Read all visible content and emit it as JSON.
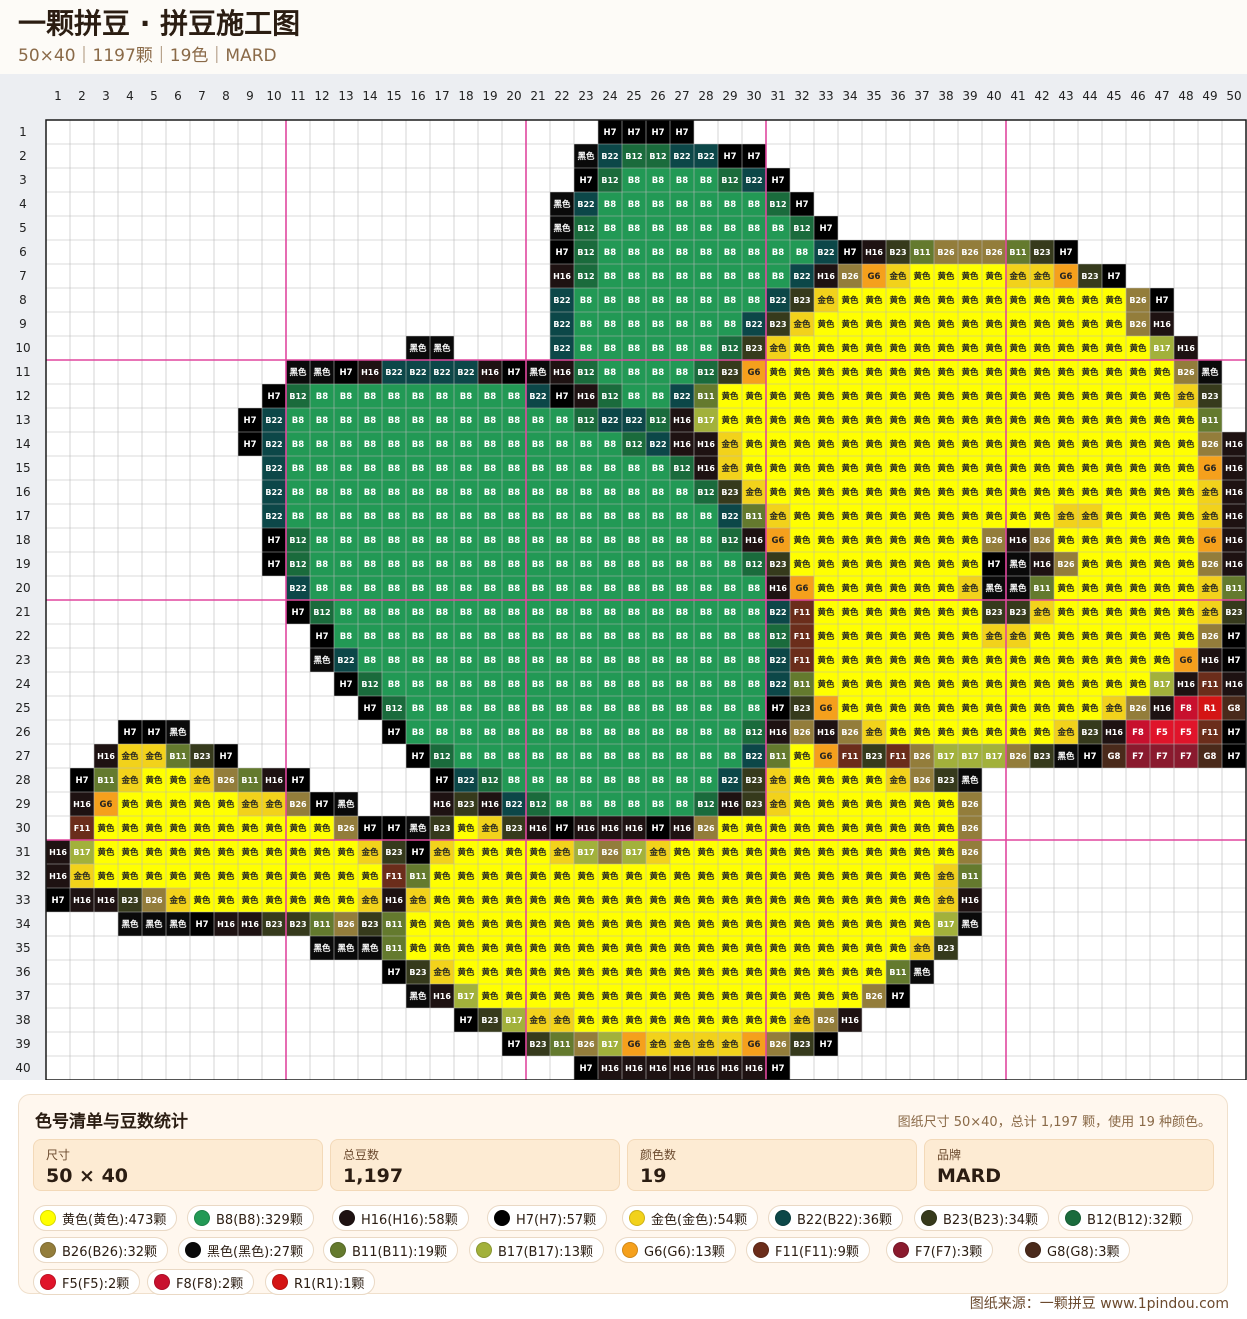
{
  "header": {
    "title": "一颗拼豆 · 拼豆施工图",
    "subtitle": "50×40｜1197颗｜19色｜MARD"
  },
  "grid": {
    "cols": 50,
    "rows": 40,
    "colors": {
      "Y": {
        "code": "黄色",
        "hex": "#ffff00",
        "dark": false
      },
      "J": {
        "code": "金色",
        "hex": "#f2d21b",
        "dark": false
      },
      "8": {
        "code": "B8",
        "hex": "#229955",
        "dark": true
      },
      "6": {
        "code": "H16",
        "hex": "#1e1212",
        "dark": true
      },
      "7": {
        "code": "H7",
        "hex": "#000000",
        "dark": true
      },
      "2": {
        "code": "B22",
        "hex": "#0c4748",
        "dark": true
      },
      "3": {
        "code": "B23",
        "hex": "#363a1c",
        "dark": true
      },
      "1": {
        "code": "B12",
        "hex": "#1a6b3c",
        "dark": true
      },
      "s": {
        "code": "B26",
        "hex": "#937d3b",
        "dark": true
      },
      "K": {
        "code": "黑色",
        "hex": "#0a0a0a",
        "dark": true
      },
      "o": {
        "code": "B11",
        "hex": "#647a2e",
        "dark": true
      },
      "r": {
        "code": "B17",
        "hex": "#a2b13b",
        "dark": true
      },
      "g": {
        "code": "G6",
        "hex": "#f5a01c",
        "dark": false
      },
      "F": {
        "code": "F11",
        "hex": "#6b2d1b",
        "dark": true
      },
      "7F": {
        "code": "F7",
        "hex": "#8a1a2e",
        "dark": true
      },
      "G": {
        "code": "G8",
        "hex": "#4a2a1b",
        "dark": true
      },
      "5": {
        "code": "F5",
        "hex": "#e0142a",
        "dark": true
      },
      "9": {
        "code": "F8",
        "hex": "#c8102e",
        "dark": true
      },
      "R": {
        "code": "R1",
        "hex": "#d41414",
        "dark": true
      }
    },
    "rows_data": [
      [
        "24:7,25:7,26:7,27:7"
      ],
      [
        "23:K,24:2,25:1,26:1,27:2,28:2,29:7,30:7"
      ],
      [
        "23:7,24:1,25-28:8,29:1,30:2,31:7"
      ],
      [
        "22:K,23:2,24-30:8,31:1,32:7"
      ],
      [
        "22:K,23:1,24-31:8,32:1,33:7"
      ],
      [
        "22:7,23:1,24-32:8,33:2,34:7,35:6,36:3,37:o,38:s,39:s,40:s,41:o,42:3,43:7"
      ],
      [
        "22:6,23:1,24-31:8,32:2,33:6,34:s,35:g,36:J,37-40:Y,41:J,42:J,43:g,44:3,45:7"
      ],
      [
        "22:2,23-30:8,31:2,32:3,33:J,34-45:Y,46:s,47:7"
      ],
      [
        "22:2,23-29:8,30:2,31:3,32:J,33-45:Y,46:s,47:6"
      ],
      [
        "16:K,17:K,22:2,23-28:8,29:1,30:3,31:J,32-46:Y,47:r,48:6"
      ],
      [
        "11:K,12:K,13:7,14:6,15:2,16:2,17:2,18:2,19:6,20:7,21:K,22:6,23:1,24-27:8,28:1,29:3,30:g,31-47:Y,48:s,49:K"
      ],
      [
        "10:7,11:1,12-20:8,21:2,22:7,23:6,24:1,25:8,26:8,27:2,28:o,29-47:Y,48:J,49:3"
      ],
      [
        "9:7,10:2,11-22:8,23:1,24:2,25:2,26:1,27:6,28:r,29-48:Y,49:o"
      ],
      [
        "9:7,10:2,11-24:8,25:1,26:2,27:6,28:6,29:J,30-48:Y,49:s,50:6"
      ],
      [
        "10:2,11-26:8,27:1,28:6,29:J,30-48:Y,49:g,50:6"
      ],
      [
        "10:2,11-27:8,28:1,29:3,30:J,31-48:Y,49:J,50:6"
      ],
      [
        "10:2,11-28:8,29:2,30:o,31:J,32-42:Y,43:J,44:J,45-48:Y,49:J,50:6"
      ],
      [
        "10:7,11:1,12-28:8,29:1,30:6,31:g,32-39:Y,40:s,41:6,42:s,43-48:Y,49:g,50:6"
      ],
      [
        "10:7,11:1,12-29:8,30:1,31:3,32-39:Y,40:7,41:K,42:6,43:s,44-48:Y,49:s,50:6"
      ],
      [
        "11:2,12-30:8,31:6,32:g,33-38:Y,39:J,40:K,41:K,42:o,43-48:Y,49:J,50:o"
      ],
      [
        "11:7,12:1,13-30:8,31:2,32:F,33-39:Y,40:3,41:3,42:J,43-48:Y,49:J,50:3"
      ],
      [
        "12:7,13-30:8,31:1,32:F,33-39:Y,40:J,41:J,42-48:Y,49:s,50:7"
      ],
      [
        "12:K,13:2,14-30:8,31:2,32:F,33-47:Y,48:g,49:6,50:7"
      ],
      [
        "13:7,14:1,15-30:8,31:2,32:o,33-46:Y,47:r,48:6,49:F,50:6"
      ],
      [
        "14:7,15:1,16-30:8,31:7,32:3,33:g,34-44:Y,45:J,46:s,47:6,48:9,49:R,50:G"
      ],
      [
        "4:7,5:7,6:K,15:7,16-29:8,30:1,31:6,32:s,33:6,34:s,35:J,36-42:Y,43:J,44:3,45:6,46:9,47:5,48:5,49:F,50:7"
      ],
      [
        "3:6,4:J,5:J,6:o,7:3,8:7,16:7,17:1,18-29:8,30:2,31:o,32:Y,33:g,34:F,35:3,36:F,37:s,38:r,39:r,40:r,41:s,42:3,43:K,44:7,45:G,46:7F,47:7F,48:7F,49:G,50:7"
      ],
      [
        "2:7,3:o,4:J,5:Y,6:Y,7:J,8:s,9:o,10:6,11:7,17:7,18:2,19:1,20-28:8,29:2,30:3,31:J,32-35:Y,36:J,37:s,38:3,39:K"
      ],
      [
        "2:6,3:g,4-8:Y,9:J,10:J,11:s,12:7,13:K,17:6,18:3,19:6,20:2,21:1,22-27:8,28:1,29:6,30:3,31:J,32-38:Y,39:s"
      ],
      [
        "2:F,3-12:Y,13:s,14:7,15:7,16:K,17:3,18:Y,19:J,20:3,21:6,22:7,23:6,24:6,25:6,26:7,27:6,28:s,29-38:Y,39:s"
      ],
      [
        "1:6,2:r,3-13:Y,14:J,15:3,16:7,17:J,18-21:Y,22:J,23:r,24:s,25:r,26:J,27-38:Y,39:s"
      ],
      [
        "1:6,2:J,3-14:Y,15:F,16:o,17-37:Y,38:J,39:o"
      ],
      [
        "1:7,2:6,3:6,4:3,5:s,6:J,7-13:Y,14:J,15:6,16:J,17-37:Y,38:J,39:6"
      ],
      [
        "4:K,5:K,6:K,7:7,8:6,9:6,10:3,11:3,12:o,13:s,14:3,15:o,16-37:Y,38:r,39:K"
      ],
      [
        "12:K,13:K,14:K,15:o,16-36:Y,37:J,38:3"
      ],
      [
        "15:7,16:3,17:J,18-35:Y,36:o,37:K"
      ],
      [
        "16:K,17:6,18:r,19-34:Y,35:s,36:7"
      ],
      [
        "18:7,19:3,20:r,21:J,22:J,23-31:Y,32:J,33:s,34:6"
      ],
      [
        "20:7,21:3,22:o,23:s,24:r,25:g,26:J,27:J,28:J,29:J,30:g,31:s,32:3,33:7"
      ],
      [
        "23:7,24:6,25:6,26:6,27:6,28:6,29:6,30:6,31:7"
      ]
    ]
  },
  "panel": {
    "title": "色号清单与豆数统计",
    "note": "图纸尺寸 50×40，总计 1,197 颗，使用 19 种颜色。",
    "stats": [
      {
        "label": "尺寸",
        "value": "50 × 40"
      },
      {
        "label": "总豆数",
        "value": "1,197"
      },
      {
        "label": "颜色数",
        "value": "19"
      },
      {
        "label": "品牌",
        "value": "MARD"
      }
    ],
    "chips": [
      {
        "text": "黄色(黄色):473颗",
        "color": "#ffff00"
      },
      {
        "text": "B8(B8):329颗",
        "color": "#229955"
      },
      {
        "text": "H16(H16):58颗",
        "color": "#1e1212"
      },
      {
        "text": "H7(H7):57颗",
        "color": "#000000"
      },
      {
        "text": "金色(金色):54颗",
        "color": "#f2d21b"
      },
      {
        "text": "B22(B22):36颗",
        "color": "#0c4748"
      },
      {
        "text": "B23(B23):34颗",
        "color": "#363a1c"
      },
      {
        "text": "B12(B12):32颗",
        "color": "#1a6b3c"
      },
      {
        "text": "B26(B26):32颗",
        "color": "#937d3b"
      },
      {
        "text": "黑色(黑色):27颗",
        "color": "#0a0a0a"
      },
      {
        "text": "B11(B11):19颗",
        "color": "#647a2e"
      },
      {
        "text": "B17(B17):13颗",
        "color": "#a2b13b"
      },
      {
        "text": "G6(G6):13颗",
        "color": "#f5a01c"
      },
      {
        "text": "F11(F11):9颗",
        "color": "#6b2d1b"
      },
      {
        "text": "F7(F7):3颗",
        "color": "#8a1a2e"
      },
      {
        "text": "G8(G8):3颗",
        "color": "#4a2a1b"
      },
      {
        "text": "F5(F5):2颗",
        "color": "#e0142a"
      },
      {
        "text": "F8(F8):2颗",
        "color": "#c8102e"
      },
      {
        "text": "R1(R1):1颗",
        "color": "#d41414"
      }
    ]
  },
  "footer": "图纸来源：一颗拼豆 www.1pindou.com"
}
